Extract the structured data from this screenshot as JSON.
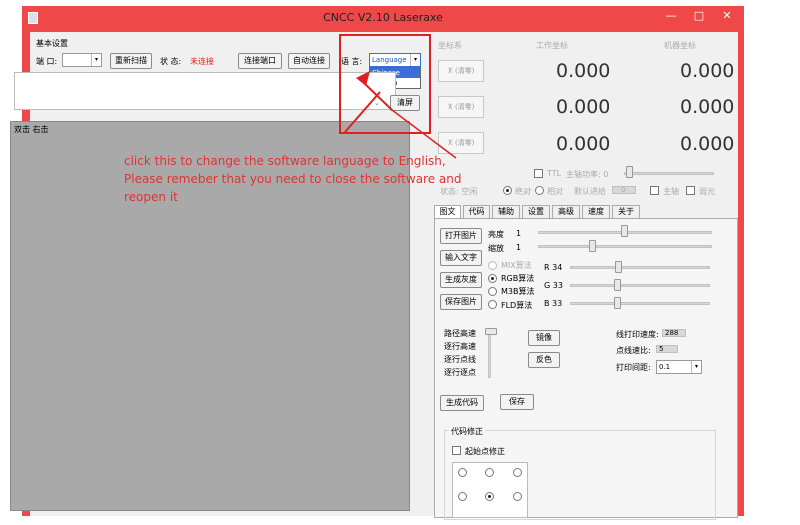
{
  "window": {
    "title": "CNCC V2.10  Laseraxe",
    "min": "—",
    "max": "□",
    "close": "✕"
  },
  "basic": {
    "group_label": "基本设置",
    "port_label": "端 口:",
    "rescan": "重新扫描",
    "status_label": "状 态:",
    "status_value": "未连接",
    "connect_port": "连接端口",
    "auto_connect": "自动连接",
    "language_label": "语 言:",
    "language_selected": "Language",
    "language_options": [
      "Chinese",
      "English"
    ],
    "clear": "清屏",
    "canvas_hint": "双击 右击"
  },
  "coords": {
    "col_headers": [
      "坐标系",
      "工作坐标",
      "机器坐标"
    ],
    "zero_label": "⊼ (清零)",
    "rows": [
      {
        "work": "0.000",
        "machine": "0.000"
      },
      {
        "work": "0.000",
        "machine": "0.000"
      },
      {
        "work": "0.000",
        "machine": "0.000"
      }
    ]
  },
  "status_row": {
    "ttl": "TTL",
    "laser_power": "主轴功率: 0",
    "state": "状态: 空闲",
    "absolute": "绝对",
    "relative": "相对",
    "default_feed": "默认进给",
    "feed_value": "0",
    "spindle": "主轴",
    "weak_light": "弱光"
  },
  "tabs": [
    "图文",
    "代码",
    "辅助",
    "设置",
    "高级",
    "速度",
    "关于"
  ],
  "image_tab": {
    "open_image": "打开图片",
    "input_text": "输入文字",
    "gen_gray": "生成灰度",
    "save_image": "保存图片",
    "brightness_label": "亮度",
    "brightness_value": "1",
    "zoom_label": "缩放",
    "zoom_value": "1",
    "algorithms": [
      "MIX算法",
      "RGB算法",
      "M3B算法",
      "FLD算法"
    ],
    "r_label": "R 34",
    "g_label": "G 33",
    "b_label": "B 33",
    "path_modes": [
      "路径高速",
      "逐行高速",
      "逐行点线",
      "逐行逐点"
    ],
    "mirror": "镜像",
    "invert": "反色",
    "line_speed_label": "线打印速度:",
    "line_speed_value": "288",
    "dot_ratio_label": "点线速比:",
    "dot_ratio_value": "5",
    "print_gap_label": "打印间距:",
    "print_gap_value": "0.1",
    "gen_code": "生成代码",
    "save": "保存",
    "code_fix_group": "代码修正",
    "origin_fix": "起始点修正"
  },
  "annotation": [
    "click this to change the software language to English,",
    "Please remeber that you need to close the software and",
    "reopen it"
  ]
}
